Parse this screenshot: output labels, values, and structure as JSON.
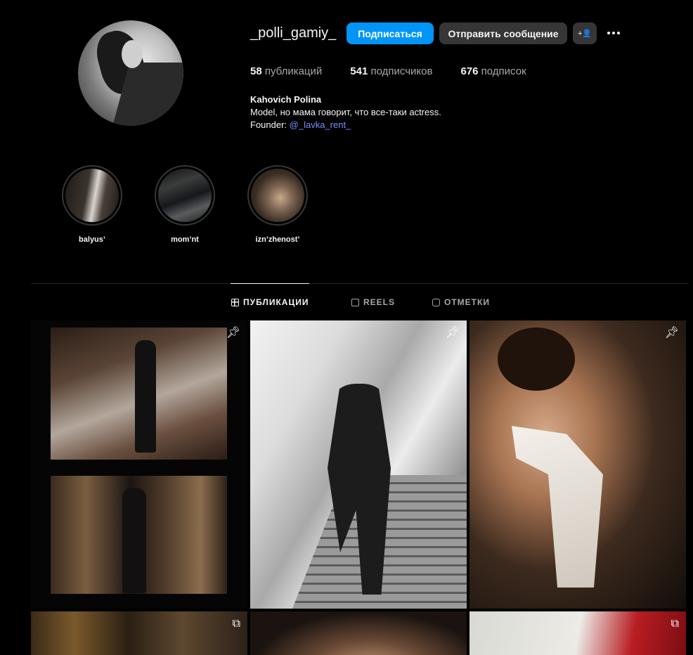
{
  "profile": {
    "username": "_polli_gamiy_",
    "follow_label": "Подписаться",
    "message_label": "Отправить сообщение",
    "suggest_label": "+👤",
    "stats": {
      "posts_count": "58",
      "posts_label": "публикаций",
      "followers_count": "541",
      "followers_label": "подписчиков",
      "following_count": "676",
      "following_label": "подписок"
    },
    "bio": {
      "name": "Kahovich Polina",
      "line1": "Model, но мама говорит, что все-таки actress.",
      "founder_label": "Founder: ",
      "founder_link": "@_lavka_rent_"
    }
  },
  "highlights": [
    {
      "label": "balyus’"
    },
    {
      "label": "mom’nt"
    },
    {
      "label": "izn’zhenost’"
    }
  ],
  "tabs": {
    "posts": "ПУБЛИКАЦИИ",
    "reels": "REELS",
    "tagged": "ОТМЕТКИ"
  },
  "posts": [
    {
      "badge": "pinned"
    },
    {
      "badge": "pinned"
    },
    {
      "badge": "pinned"
    },
    {
      "badge": "carousel"
    },
    {
      "badge": "none"
    },
    {
      "badge": "carousel"
    }
  ],
  "icons": {
    "pin": "pin-icon",
    "carousel": "carousel-icon",
    "grid": "grid-icon",
    "reels": "reels-icon",
    "tagged": "tagged-icon"
  },
  "colors": {
    "accent": "#0095f6",
    "link": "#7a8cff",
    "button_secondary": "#363636"
  }
}
